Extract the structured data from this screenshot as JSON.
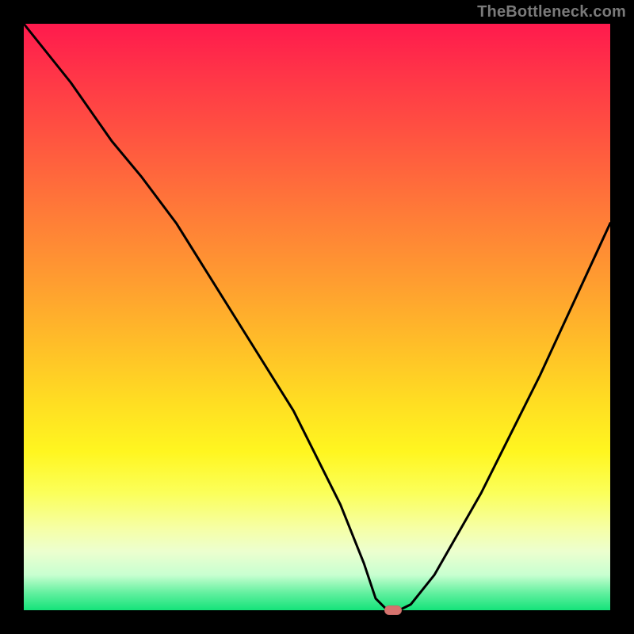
{
  "watermark": "TheBottleneck.com",
  "colors": {
    "gradient_top": "#ff1a4d",
    "gradient_mid": "#ffdf22",
    "gradient_bottom": "#14e37a",
    "curve": "#000000",
    "marker": "#d6736e",
    "frame": "#000000"
  },
  "chart_data": {
    "type": "line",
    "title": "",
    "xlabel": "",
    "ylabel": "",
    "xlim": [
      0,
      100
    ],
    "ylim": [
      0,
      100
    ],
    "grid": false,
    "legend": false,
    "annotations": [
      {
        "type": "pill-marker",
        "x": 63,
        "y": 0
      }
    ],
    "series": [
      {
        "name": "bottleneck-curve",
        "x": [
          0,
          8,
          15,
          20,
          26,
          36,
          46,
          54,
          58,
          60,
          62,
          64,
          66,
          70,
          78,
          88,
          100
        ],
        "y": [
          100,
          90,
          80,
          74,
          66,
          50,
          34,
          18,
          8,
          2,
          0,
          0,
          1,
          6,
          20,
          40,
          66
        ]
      }
    ],
    "notes": "y is plotted as fraction of vertical extent from the bottom edge (0=bottom, 100=top). Values are visual estimates."
  }
}
